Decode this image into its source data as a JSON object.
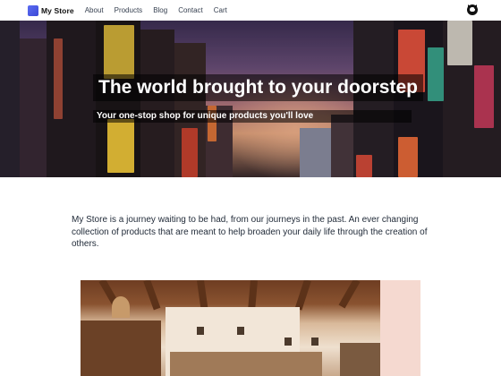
{
  "nav": {
    "brand": "My Store",
    "links": [
      "About",
      "Products",
      "Blog",
      "Contact",
      "Cart"
    ],
    "github_icon": "github-icon"
  },
  "hero": {
    "title": "The world brought to your doorstep",
    "subtitle": "Your one-stop shop for unique products you'll love"
  },
  "intro": {
    "text": "My Store is a journey waiting to be had, from our journeys in the past. An ever changing collection of products that are meant to help broaden your daily life through the creation of others."
  },
  "colors": {
    "brand": "#4f5ee8",
    "text": "#1f2937",
    "hero_overlay": "#000000"
  }
}
